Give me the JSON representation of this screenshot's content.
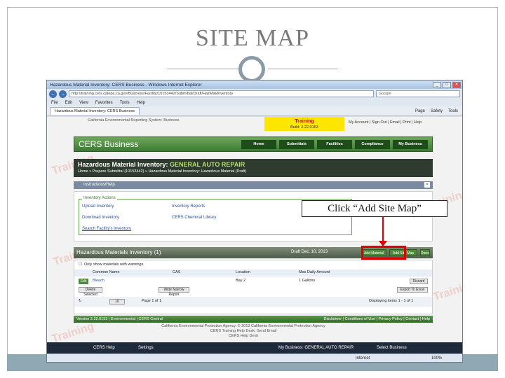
{
  "slide": {
    "title": "SITE MAP",
    "callout": "Click “Add Site Map”"
  },
  "browser": {
    "window_title": "Hazardous Material Inventory: CERS Business - Windows Internet Explorer",
    "address": "http://training.cers.calepa.ca.gov/Business/Facility/10153442/Submittal/Draft/HazMat/Inventory",
    "search_placeholder": "Google",
    "menu": [
      "File",
      "Edit",
      "View",
      "Favorites",
      "Tools",
      "Help"
    ],
    "tab_label": "Hazardous Material Inventory: CERS Business",
    "tools": [
      "Page",
      "Safety",
      "Tools"
    ],
    "status": "Internet",
    "zoom": "100%"
  },
  "page": {
    "agency": "California Environmental Reporting System: Business",
    "training": {
      "label": "Training",
      "build": "Build: 2.22.0153"
    },
    "user_links": [
      "My Account",
      "Sign Out",
      "Email",
      "Print",
      "Help"
    ],
    "logo": "CERS Business",
    "nav": [
      "Home",
      "Submittals",
      "Facilities",
      "Compliance",
      "My Business"
    ],
    "hazmat": {
      "title_prefix": "Hazardous Material Inventory:",
      "title_facility": "GENERAL AUTO REPAIR",
      "breadcrumb": "Home » Prepare Submittal (10153442) » Hazardous Material Inventory: Hazardous Material (Draft)"
    },
    "help_bar": "Instructions/Help",
    "actions": {
      "legend": "Inventory Actions",
      "links": [
        "Upload Inventory",
        "Inventory Reports",
        "Download Inventory",
        "CERS Chemical Library",
        "Search Facility's Inventory"
      ]
    },
    "inventory": {
      "title": "Hazardous Materials Inventory (1)",
      "draft": "Draft Dec. 10, 2013",
      "buttons": [
        "Add Material",
        "Add Site Map",
        "Done"
      ]
    },
    "grid": {
      "checkbox_label": "Only show materials with warnings",
      "columns": [
        "Common Name",
        "CAS",
        "Location",
        "Max Daily Amount"
      ],
      "rows": [
        {
          "edit": "Edit",
          "name": "Bleach",
          "cas": "",
          "location": "Bay 2",
          "amount": "1 Gallons",
          "action": "Discard"
        }
      ],
      "toolbar_left": [
        "Delete Selected",
        "Wide Narrow Report"
      ],
      "toolbar_right": "Export To Excel",
      "pager_size": "10",
      "pager_page": "Page 1 of 1",
      "displaying": "Displaying items 1 - 1 of 1"
    },
    "footer_left": "Version 2.22.0153 | Environmental | CERS Central",
    "footer_right": "Disclaimer | Conditions of Use | Privacy Policy | Contact | Help",
    "copyright": [
      "California Environmental Protection Agency. © 2013 California Environmental Protection Agency",
      "CERS Training Help Desk: Send Email",
      "CERS Help Desk"
    ],
    "taskbar": [
      "CERS Help",
      "Settings",
      "My Business: GENERAL AUTO REPAIR",
      "Select Business"
    ]
  }
}
